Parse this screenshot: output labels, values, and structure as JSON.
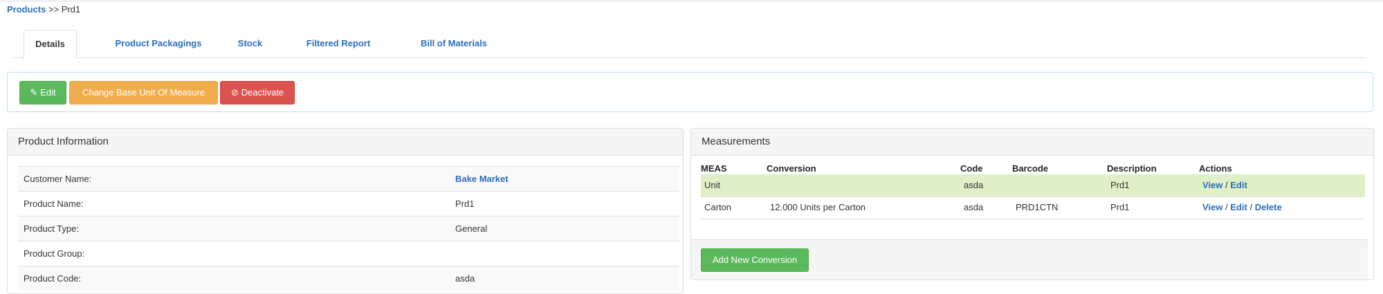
{
  "breadcrumb": {
    "root": "Products",
    "separator": ">>",
    "current": "Prd1"
  },
  "tabs": [
    {
      "label": "Details",
      "active": true
    },
    {
      "label": "Product Packagings"
    },
    {
      "label": "Stock"
    },
    {
      "label": "Filtered Report"
    },
    {
      "label": "Bill of Materials"
    }
  ],
  "toolbar": {
    "edit": "Edit",
    "change_uom": "Change Base Unit Of Measure",
    "deactivate": "Deactivate"
  },
  "product_info": {
    "title": "Product Information",
    "rows": [
      {
        "label": "Customer Name:",
        "value": "Bake Market"
      },
      {
        "label": "Product Name:",
        "value": "Prd1"
      },
      {
        "label": "Product Type:",
        "value": "General"
      },
      {
        "label": "Product Group:",
        "value": ""
      },
      {
        "label": "Product Code:",
        "value": "asda"
      }
    ]
  },
  "measurements": {
    "title": "Measurements",
    "headers": [
      "MEAS",
      "Conversion",
      "Code",
      "Barcode",
      "Description",
      "Actions"
    ],
    "rows": [
      {
        "meas": "Unit",
        "conversion": "",
        "code": "asda",
        "barcode": "",
        "description": "Prd1",
        "actions": [
          "View",
          "Edit"
        ]
      },
      {
        "meas": "Carton",
        "conversion": "12.000 Units per Carton",
        "code": "asda",
        "barcode": "PRD1CTN",
        "description": "Prd1",
        "actions": [
          "View",
          "Edit",
          "Delete"
        ]
      }
    ],
    "add_button": "Add New Conversion"
  },
  "colors": {
    "link": "#2a6ebb",
    "success": "#5cb85c",
    "warning": "#f0ad4e",
    "danger": "#d9534f",
    "row_highlight": "#dff0c8"
  }
}
